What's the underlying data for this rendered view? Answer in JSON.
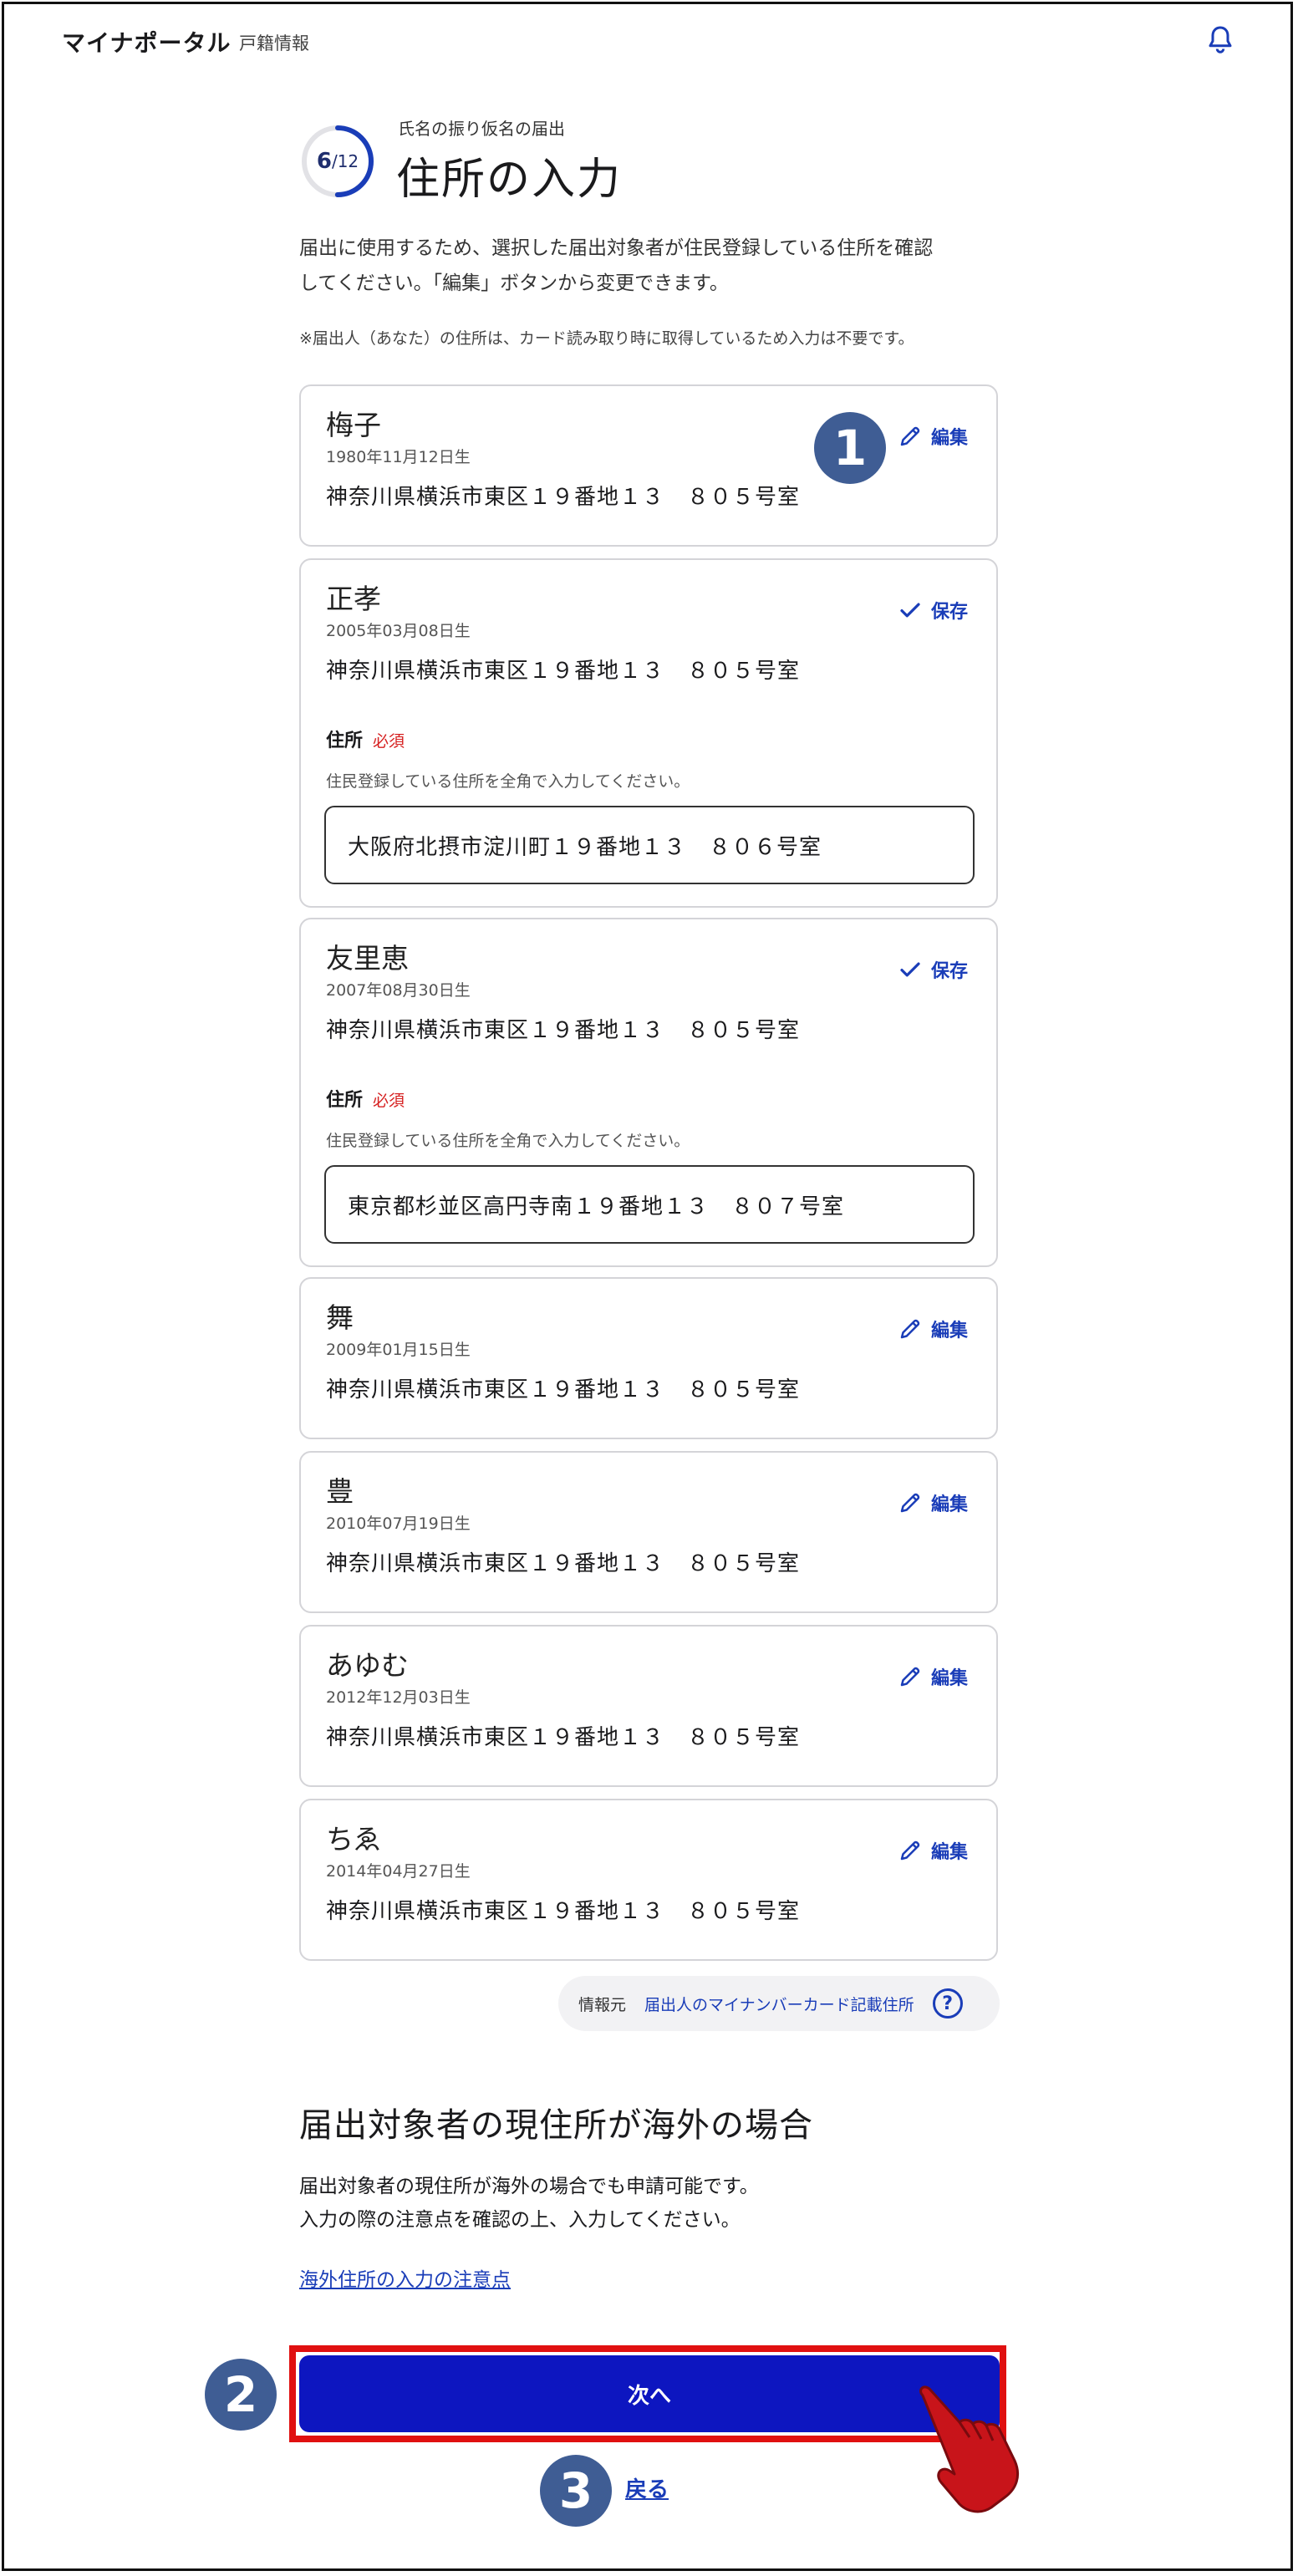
{
  "header": {
    "app_name": "マイナポータル",
    "section": "戸籍情報",
    "icon": "bell-icon"
  },
  "progress": {
    "current": "6",
    "total": "/12",
    "fraction": 0.5
  },
  "step_caption": "氏名の振り仮名の届出",
  "page_title": "住所の入力",
  "description_line1": "届出に使用するため、選択した届出対象者が住民登録している住所を確認",
  "description_line2": "してください。「編集」ボタンから変更できます。",
  "note": "※届出人（あなた）の住所は、カード読み取り時に取得しているため入力は不要です。",
  "labels": {
    "edit": "編集",
    "save": "保存",
    "field_label": "住所",
    "required": "必須",
    "hint": "住民登録している住所を全角で入力してください。"
  },
  "persons": [
    {
      "name": "梅子",
      "dob": "1980年11月12日生",
      "address": "神奈川県横浜市東区１９番地１３　８０５号室",
      "mode": "edit"
    },
    {
      "name": "正孝",
      "dob": "2005年03月08日生",
      "address": "神奈川県横浜市東区１９番地１３　８０５号室",
      "mode": "save",
      "input": "大阪府北摂市淀川町１９番地１３　８０６号室"
    },
    {
      "name": "友里恵",
      "dob": "2007年08月30日生",
      "address": "神奈川県横浜市東区１９番地１３　８０５号室",
      "mode": "save",
      "input": "東京都杉並区高円寺南１９番地１３　８０７号室"
    },
    {
      "name": "舞",
      "dob": "2009年01月15日生",
      "address": "神奈川県横浜市東区１９番地１３　８０５号室",
      "mode": "edit"
    },
    {
      "name": "豊",
      "dob": "2010年07月19日生",
      "address": "神奈川県横浜市東区１９番地１３　８０５号室",
      "mode": "edit"
    },
    {
      "name": "あゆむ",
      "dob": "2012年12月03日生",
      "address": "神奈川県横浜市東区１９番地１３　８０５号室",
      "mode": "edit"
    },
    {
      "name": "ちゑ",
      "dob": "2014年04月27日生",
      "address": "神奈川県横浜市東区１９番地１３　８０５号室",
      "mode": "edit"
    }
  ],
  "source": {
    "label": "情報元",
    "value": "届出人のマイナンバーカード記載住所",
    "help": "?"
  },
  "overseas": {
    "title": "届出対象者の現住所が海外の場合",
    "body_line1": "届出対象者の現住所が海外の場合でも申請可能です。",
    "body_line2": "入力の際の注意点を確認の上、入力してください。",
    "link": "海外住所の入力の注意点"
  },
  "buttons": {
    "next": "次へ",
    "back": "戻る"
  },
  "annotations": {
    "badge1": "1",
    "badge2": "2",
    "badge3": "3"
  },
  "colors": {
    "primary": "#0d16c0",
    "link": "#1a3db8",
    "required": "#d62020",
    "highlight": "#e01010",
    "badge": "#3f5d94",
    "hand": "#c8141a"
  }
}
